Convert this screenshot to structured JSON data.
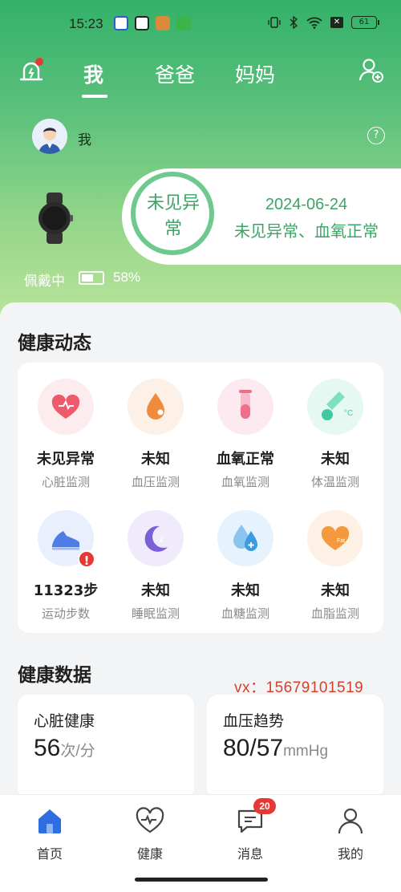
{
  "status_bar": {
    "time": "15:23",
    "battery": "61"
  },
  "top_tabs": [
    {
      "label": "我",
      "active": true
    },
    {
      "label": "爸爸",
      "active": false
    },
    {
      "label": "妈妈",
      "active": false
    }
  ],
  "profile": {
    "name": "我"
  },
  "health_status": {
    "ring_text": "未见异常",
    "date": "2024-06-24",
    "summary": "未见异常、血氧正常"
  },
  "device": {
    "wear_label": "佩戴中",
    "battery_percent": "58%",
    "battery_level": 0.58
  },
  "health_dynamic": {
    "title": "健康动态",
    "items": [
      {
        "value": "未见异常",
        "label": "心脏监测",
        "icon": "heart-icon",
        "color": "#ef5a6a"
      },
      {
        "value": "未知",
        "label": "血压监测",
        "icon": "blood-drop-icon",
        "color": "#f08a3c"
      },
      {
        "value": "血氧正常",
        "label": "血氧监测",
        "icon": "test-tube-icon",
        "color": "#ef6e8a"
      },
      {
        "value": "未知",
        "label": "体温监测",
        "icon": "thermometer-icon",
        "color": "#3fc9a3"
      },
      {
        "value": "11323步",
        "label": "运动步数",
        "icon": "shoe-icon",
        "color": "#4f7de8"
      },
      {
        "value": "未知",
        "label": "睡眠监测",
        "icon": "moon-icon",
        "color": "#7b5fd9"
      },
      {
        "value": "未知",
        "label": "血糖监测",
        "icon": "glucose-drop-icon",
        "color": "#3b9be3"
      },
      {
        "value": "未知",
        "label": "血脂监测",
        "icon": "fat-heart-icon",
        "color": "#f39a3e"
      }
    ]
  },
  "health_data": {
    "title": "健康数据",
    "contact": "vx：15679101519",
    "cards": [
      {
        "title": "心脏健康",
        "value": "56",
        "unit": "次/分"
      },
      {
        "title": "血压趋势",
        "value": "80/57",
        "unit": "mmHg"
      }
    ]
  },
  "bottom_nav": [
    {
      "label": "首页",
      "icon": "home-icon",
      "active": true
    },
    {
      "label": "健康",
      "icon": "heart-pulse-icon",
      "active": false
    },
    {
      "label": "消息",
      "icon": "message-icon",
      "active": false,
      "badge": "20"
    },
    {
      "label": "我的",
      "icon": "person-icon",
      "active": false
    }
  ]
}
